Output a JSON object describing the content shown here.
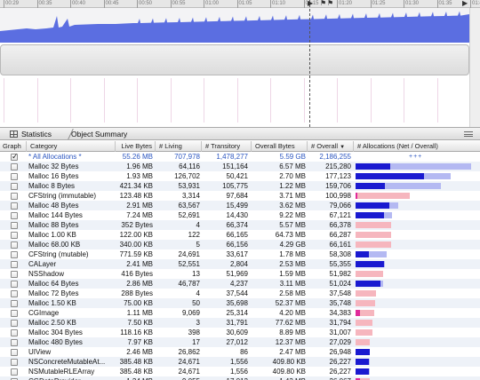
{
  "timeline": {
    "ruler_labels": [
      "00:29",
      "00:35",
      "00:40",
      "00:45",
      "00:50",
      "00:55",
      "01:00",
      "01:05",
      "01:10",
      "01:15",
      "01:20",
      "01:25",
      "01:30",
      "01:35",
      "01:40"
    ],
    "graph_color": "#5b6ee1"
  },
  "nav": {
    "statistics": "Statistics",
    "object_summary": "Object Summary"
  },
  "columns": {
    "graph": "Graph",
    "category": "Category",
    "live_bytes": "Live Bytes",
    "living": "# Living",
    "transitory": "# Transitory",
    "overall_bytes": "Overall Bytes",
    "overall": "# Overall",
    "overall_sort_arrow": "▼",
    "allocations": "# Allocations (Net / Overall)"
  },
  "colors": {
    "net_blue": "#1a1ad0",
    "overall_blue": "#b4b9f2",
    "net_pink": "#e02a9a",
    "overall_pink": "#f6b6be",
    "summary_text": "#2a55c0"
  },
  "summary_row": {
    "category": "* All Allocations *",
    "live_bytes": "55.26 MB",
    "living": "707,978",
    "transitory": "1,478,277",
    "overall_bytes": "5.59 GB",
    "overall": "2,186,255",
    "indicator": "+++",
    "checked": true
  },
  "rows": [
    {
      "category": "Malloc 32 Bytes",
      "live_bytes": "1.96 MB",
      "living": "64,116",
      "transitory": "151,164",
      "overall_bytes": "6.57 MB",
      "overall": "215,280",
      "color": "blue"
    },
    {
      "category": "Malloc 16 Bytes",
      "live_bytes": "1.93 MB",
      "living": "126,702",
      "transitory": "50,421",
      "overall_bytes": "2.70 MB",
      "overall": "177,123",
      "color": "blue"
    },
    {
      "category": "Malloc 8 Bytes",
      "live_bytes": "421.34 KB",
      "living": "53,931",
      "transitory": "105,775",
      "overall_bytes": "1.22 MB",
      "overall": "159,706",
      "color": "blue"
    },
    {
      "category": "CFString (immutable)",
      "live_bytes": "123.48 KB",
      "living": "3,314",
      "transitory": "97,684",
      "overall_bytes": "3.71 MB",
      "overall": "100,998",
      "color": "pink"
    },
    {
      "category": "Malloc 48 Bytes",
      "live_bytes": "2.91 MB",
      "living": "63,567",
      "transitory": "15,499",
      "overall_bytes": "3.62 MB",
      "overall": "79,066",
      "color": "blue"
    },
    {
      "category": "Malloc 144 Bytes",
      "live_bytes": "7.24 MB",
      "living": "52,691",
      "transitory": "14,430",
      "overall_bytes": "9.22 MB",
      "overall": "67,121",
      "color": "blue"
    },
    {
      "category": "Malloc 88 Bytes",
      "live_bytes": "352 Bytes",
      "living": "4",
      "transitory": "66,374",
      "overall_bytes": "5.57 MB",
      "overall": "66,378",
      "color": "pink"
    },
    {
      "category": "Malloc 1.00 KB",
      "live_bytes": "122.00 KB",
      "living": "122",
      "transitory": "66,165",
      "overall_bytes": "64.73 MB",
      "overall": "66,287",
      "color": "pink"
    },
    {
      "category": "Malloc 68.00 KB",
      "live_bytes": "340.00 KB",
      "living": "5",
      "transitory": "66,156",
      "overall_bytes": "4.29 GB",
      "overall": "66,161",
      "color": "pink"
    },
    {
      "category": "CFString (mutable)",
      "live_bytes": "771.59 KB",
      "living": "24,691",
      "transitory": "33,617",
      "overall_bytes": "1.78 MB",
      "overall": "58,308",
      "color": "blue"
    },
    {
      "category": "CALayer",
      "live_bytes": "2.41 MB",
      "living": "52,551",
      "transitory": "2,804",
      "overall_bytes": "2.53 MB",
      "overall": "55,355",
      "color": "blue"
    },
    {
      "category": "NSShadow",
      "live_bytes": "416 Bytes",
      "living": "13",
      "transitory": "51,969",
      "overall_bytes": "1.59 MB",
      "overall": "51,982",
      "color": "pink"
    },
    {
      "category": "Malloc 64 Bytes",
      "live_bytes": "2.86 MB",
      "living": "46,787",
      "transitory": "4,237",
      "overall_bytes": "3.11 MB",
      "overall": "51,024",
      "color": "blue"
    },
    {
      "category": "Malloc 72 Bytes",
      "live_bytes": "288 Bytes",
      "living": "4",
      "transitory": "37,544",
      "overall_bytes": "2.58 MB",
      "overall": "37,548",
      "color": "pink"
    },
    {
      "category": "Malloc 1.50 KB",
      "live_bytes": "75.00 KB",
      "living": "50",
      "transitory": "35,698",
      "overall_bytes": "52.37 MB",
      "overall": "35,748",
      "color": "pink"
    },
    {
      "category": "CGImage",
      "live_bytes": "1.11 MB",
      "living": "9,069",
      "transitory": "25,314",
      "overall_bytes": "4.20 MB",
      "overall": "34,383",
      "color": "pink"
    },
    {
      "category": "Malloc 2.50 KB",
      "live_bytes": "7.50 KB",
      "living": "3",
      "transitory": "31,791",
      "overall_bytes": "77.62 MB",
      "overall": "31,794",
      "color": "pink"
    },
    {
      "category": "Malloc 304 Bytes",
      "live_bytes": "118.16 KB",
      "living": "398",
      "transitory": "30,609",
      "overall_bytes": "8.89 MB",
      "overall": "31,007",
      "color": "pink"
    },
    {
      "category": "Malloc 480 Bytes",
      "live_bytes": "7.97 KB",
      "living": "17",
      "transitory": "27,012",
      "overall_bytes": "12.37 MB",
      "overall": "27,029",
      "color": "pink"
    },
    {
      "category": "UIView",
      "live_bytes": "2.46 MB",
      "living": "26,862",
      "transitory": "86",
      "overall_bytes": "2.47 MB",
      "overall": "26,948",
      "color": "blue"
    },
    {
      "category": "NSConcreteMutableAt...",
      "live_bytes": "385.48 KB",
      "living": "24,671",
      "transitory": "1,556",
      "overall_bytes": "409.80 KB",
      "overall": "26,227",
      "color": "blue"
    },
    {
      "category": "NSMutableRLEArray",
      "live_bytes": "385.48 KB",
      "living": "24,671",
      "transitory": "1,556",
      "overall_bytes": "409.80 KB",
      "overall": "26,227",
      "color": "blue"
    },
    {
      "category": "CGDataProvider",
      "live_bytes": "1.24 MB",
      "living": "9,055",
      "transitory": "17,012",
      "overall_bytes": "1.43 MB",
      "overall": "26,067",
      "color": "pink"
    }
  ]
}
